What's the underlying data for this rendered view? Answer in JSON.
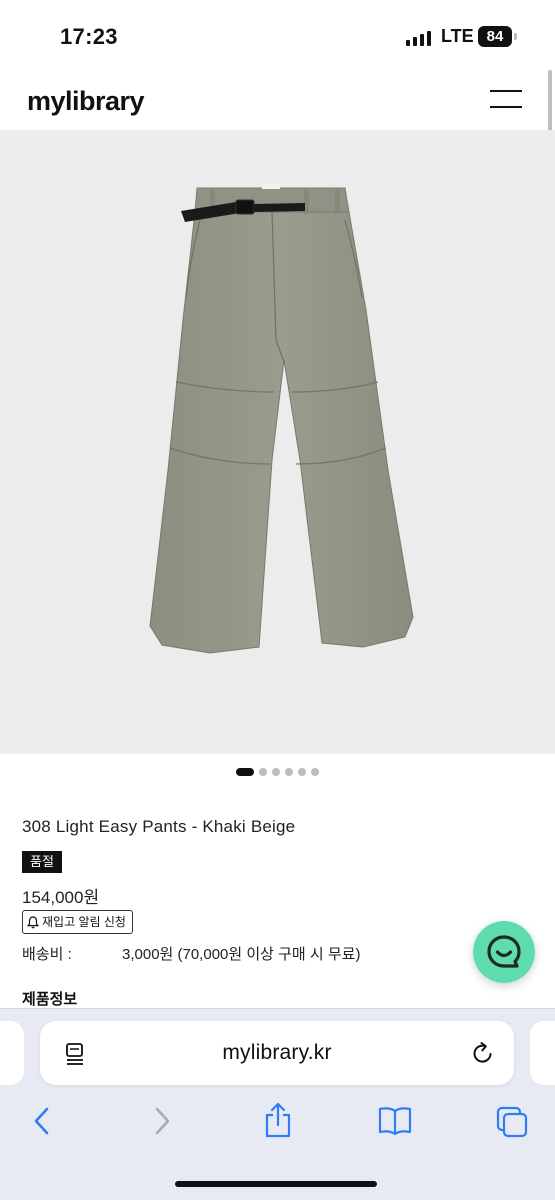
{
  "status_bar": {
    "time": "17:23",
    "network": "LTE",
    "battery": "84"
  },
  "header": {
    "logo": "mylibrary",
    "menu_icon": "hamburger-menu-icon"
  },
  "gallery": {
    "image_alt": "khaki beige wide pants with black belt",
    "slide_count": 6,
    "active_index": 0
  },
  "product": {
    "title": "308 Light Easy Pants - Khaki Beige",
    "soldout_badge": "품절",
    "price": "154,000원",
    "restock_button": "재입고 알림 신청",
    "restock_icon": "bell-icon",
    "shipping_label": "배송비 :",
    "shipping_value": "3,000원 (70,000원 이상 구매 시 무료)",
    "info_heading": "제품정보"
  },
  "chat": {
    "icon": "chat-bubble-smile-icon",
    "color": "#5fdcae"
  },
  "browser": {
    "url": "mylibrary.kr",
    "reader_icon": "reader-mode-icon",
    "reload_icon": "reload-icon",
    "toolbar_icons": [
      "back-icon",
      "forward-icon",
      "share-icon",
      "bookmarks-icon",
      "tabs-icon"
    ],
    "accent_color": "#2f7cf6"
  }
}
